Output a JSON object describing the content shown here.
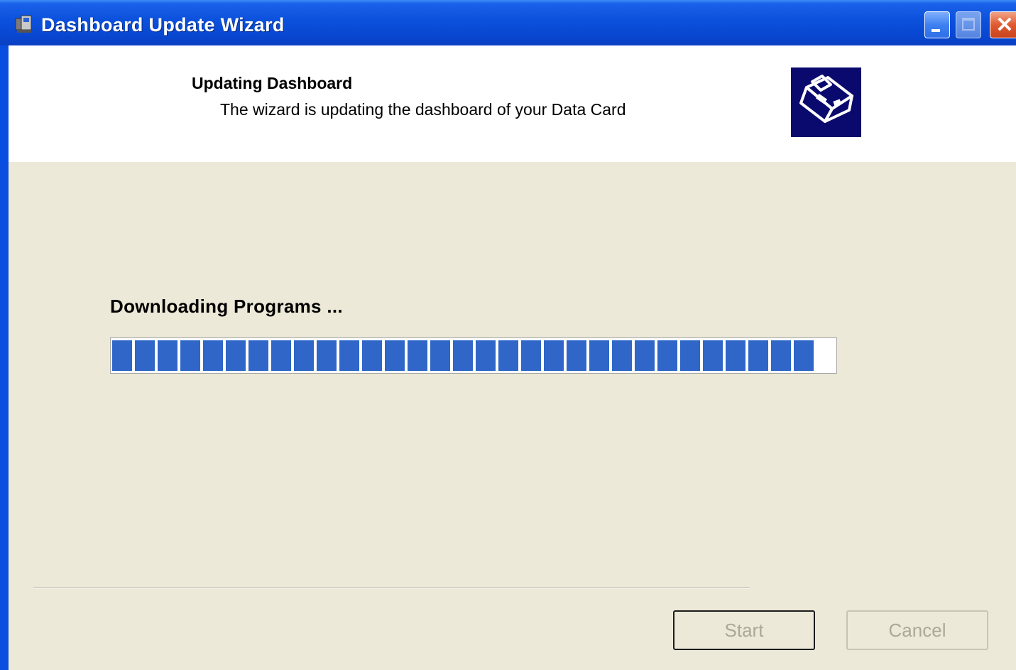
{
  "window": {
    "title": "Dashboard Update Wizard",
    "controls": {
      "minimize": "minimize-icon",
      "maximize": "maximize-icon",
      "close_glyph": "✕"
    }
  },
  "header": {
    "title": "Updating Dashboard",
    "subtitle": "The wizard is updating the dashboard of your Data Card",
    "graphic_icon": "wizard-computer-icon"
  },
  "progress": {
    "label": "Downloading Programs ...",
    "value": 1.0,
    "color": "#2f66c8"
  },
  "buttons": {
    "start_label": "Start",
    "cancel_label": "Cancel",
    "enabled": false
  },
  "colors": {
    "titlebar": "#0b50dc",
    "dialog_bg": "#ece9d8",
    "disabled_text": "#aca899"
  }
}
